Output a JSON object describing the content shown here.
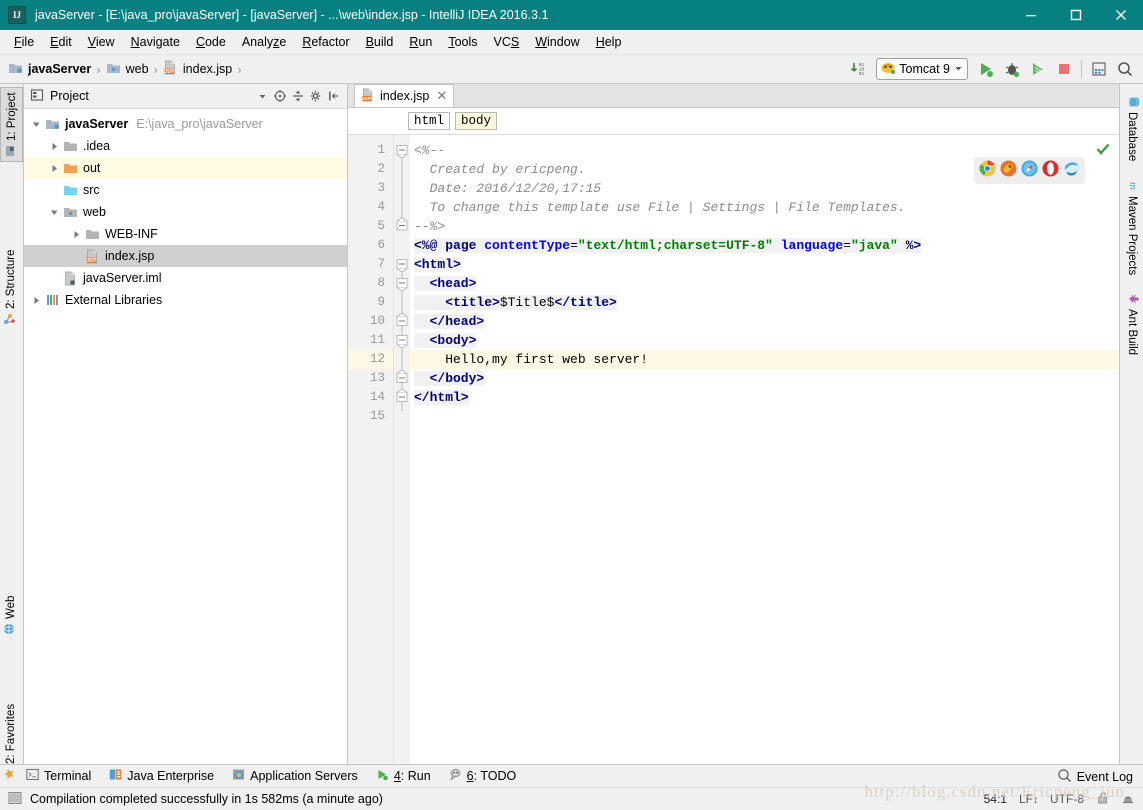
{
  "window": {
    "title": "javaServer - [E:\\java_pro\\javaServer] - [javaServer] - ...\\web\\index.jsp - IntelliJ IDEA 2016.3.1",
    "logo_text": "IJ",
    "accent_color": "#068080",
    "controls": {
      "minimize": "minimize-icon",
      "maximize": "maximize-icon",
      "close": "close-icon"
    }
  },
  "menubar": {
    "items": [
      {
        "label": "File",
        "mnemonic": "F"
      },
      {
        "label": "Edit",
        "mnemonic": "E"
      },
      {
        "label": "View",
        "mnemonic": "V"
      },
      {
        "label": "Navigate",
        "mnemonic": "N"
      },
      {
        "label": "Code",
        "mnemonic": "C"
      },
      {
        "label": "Analyze",
        "mnemonic": "z"
      },
      {
        "label": "Refactor",
        "mnemonic": "R"
      },
      {
        "label": "Build",
        "mnemonic": "B"
      },
      {
        "label": "Run",
        "mnemonic": "R"
      },
      {
        "label": "Tools",
        "mnemonic": "T"
      },
      {
        "label": "VCS",
        "mnemonic": "S"
      },
      {
        "label": "Window",
        "mnemonic": "W"
      },
      {
        "label": "Help",
        "mnemonic": "H"
      }
    ]
  },
  "navbar": {
    "crumbs": [
      {
        "label": "javaServer",
        "icon": "module-icon",
        "bold": true
      },
      {
        "label": "web",
        "icon": "source-folder-icon",
        "bold": false
      },
      {
        "label": "index.jsp",
        "icon": "jsp-file-icon",
        "bold": false
      }
    ],
    "separator": "›",
    "run_config": {
      "name": "Tomcat 9",
      "icon": "tomcat-icon",
      "dropdown": "chevron-down-icon"
    },
    "buttons": [
      {
        "name": "update-running-application-icon",
        "title": "Update"
      },
      {
        "name": "run-icon",
        "title": "Run"
      },
      {
        "name": "debug-icon",
        "title": "Debug"
      },
      {
        "name": "run-with-coverage-icon",
        "title": "Run with Coverage"
      },
      {
        "name": "stop-icon",
        "title": "Stop"
      },
      {
        "name": "project-structure-icon",
        "title": "Project Structure"
      },
      {
        "name": "search-everywhere-icon",
        "title": "Search Everywhere"
      }
    ]
  },
  "left_stripe": {
    "tabs": [
      {
        "label": "1: Project",
        "icon": "project-icon",
        "active": true
      },
      {
        "label": "2: Structure",
        "icon": "structure-icon",
        "active": false
      },
      {
        "label": "Web",
        "icon": "web-icon",
        "active": false
      },
      {
        "label": "2: Favorites",
        "icon": "star-icon",
        "active": false
      }
    ]
  },
  "right_stripe": {
    "tabs": [
      {
        "label": "Database",
        "icon": "database-icon"
      },
      {
        "label": "Maven Projects",
        "icon": "maven-icon"
      },
      {
        "label": "Ant Build",
        "icon": "ant-icon"
      }
    ]
  },
  "project_panel": {
    "title": "Project",
    "title_icon": "project-view-icon",
    "toolbar": [
      {
        "name": "view-mode-dropdown-icon"
      },
      {
        "name": "scroll-from-source-icon"
      },
      {
        "name": "collapse-all-icon"
      },
      {
        "name": "settings-gear-icon"
      },
      {
        "name": "hide-panel-icon"
      }
    ],
    "tree": [
      {
        "label": "javaServer",
        "sub": "E:\\java_pro\\javaServer",
        "indent": 0,
        "twisty": "expanded",
        "icon": "module-icon",
        "bold": true,
        "state": "normal"
      },
      {
        "label": ".idea",
        "sub": "",
        "indent": 1,
        "twisty": "collapsed",
        "icon": "folder-icon",
        "bold": false,
        "state": "normal"
      },
      {
        "label": "out",
        "sub": "",
        "indent": 1,
        "twisty": "collapsed",
        "icon": "excluded-folder-icon",
        "bold": false,
        "state": "highlight"
      },
      {
        "label": "src",
        "sub": "",
        "indent": 1,
        "twisty": "none",
        "icon": "source-root-icon",
        "bold": false,
        "state": "normal"
      },
      {
        "label": "web",
        "sub": "",
        "indent": 1,
        "twisty": "expanded",
        "icon": "web-root-icon",
        "bold": false,
        "state": "normal"
      },
      {
        "label": "WEB-INF",
        "sub": "",
        "indent": 2,
        "twisty": "collapsed",
        "icon": "folder-icon",
        "bold": false,
        "state": "normal"
      },
      {
        "label": "index.jsp",
        "sub": "",
        "indent": 2,
        "twisty": "none",
        "icon": "jsp-file-icon",
        "bold": false,
        "state": "selected"
      },
      {
        "label": "javaServer.iml",
        "sub": "",
        "indent": 1,
        "twisty": "none",
        "icon": "iml-file-icon",
        "bold": false,
        "state": "normal"
      },
      {
        "label": "External Libraries",
        "sub": "",
        "indent": 0,
        "twisty": "collapsed",
        "icon": "libraries-icon",
        "bold": false,
        "state": "normal"
      }
    ]
  },
  "editor": {
    "tab": {
      "label": "index.jsp",
      "icon": "jsp-file-icon",
      "close": "close-icon"
    },
    "tag_breadcrumbs": [
      {
        "label": "html",
        "highlight": false
      },
      {
        "label": "body",
        "highlight": true
      }
    ],
    "browser_popup": [
      {
        "name": "chrome-icon"
      },
      {
        "name": "firefox-icon"
      },
      {
        "name": "safari-icon"
      },
      {
        "name": "opera-icon"
      },
      {
        "name": "explorer-icon"
      }
    ],
    "inspection_status": "no-errors-check-icon",
    "lines": [
      {
        "num": 1,
        "fold": "start",
        "highlight": false,
        "tokens": [
          {
            "t": "<%--",
            "c": "cmt"
          }
        ]
      },
      {
        "num": 2,
        "fold": "bar",
        "highlight": false,
        "tokens": [
          {
            "t": "  Created by ericpeng.",
            "c": "cmt"
          }
        ]
      },
      {
        "num": 3,
        "fold": "bar",
        "highlight": false,
        "tokens": [
          {
            "t": "  Date: 2016/12/20,17:15",
            "c": "cmt"
          }
        ]
      },
      {
        "num": 4,
        "fold": "bar",
        "highlight": false,
        "tokens": [
          {
            "t": "  To change this template use File | Settings | File Templates.",
            "c": "cmt"
          }
        ]
      },
      {
        "num": 5,
        "fold": "end",
        "highlight": false,
        "tokens": [
          {
            "t": "--%>",
            "c": "cmt"
          }
        ]
      },
      {
        "num": 6,
        "fold": "none",
        "highlight": false,
        "tokens": [
          {
            "t": "<%@ ",
            "c": "tag"
          },
          {
            "t": "page ",
            "c": "tag"
          },
          {
            "t": "contentType",
            "c": "attr"
          },
          {
            "t": "=",
            "c": "txt"
          },
          {
            "t": "\"text/html;charset=UTF-8\"",
            "c": "str"
          },
          {
            "t": " ",
            "c": "txt"
          },
          {
            "t": "language",
            "c": "attr"
          },
          {
            "t": "=",
            "c": "txt"
          },
          {
            "t": "\"java\"",
            "c": "str"
          },
          {
            "t": " %>",
            "c": "tag"
          }
        ]
      },
      {
        "num": 7,
        "fold": "start",
        "highlight": false,
        "tokens": [
          {
            "t": "<html>",
            "c": "tag"
          }
        ]
      },
      {
        "num": 8,
        "fold": "start",
        "highlight": false,
        "tokens": [
          {
            "t": "  <head>",
            "c": "tag"
          }
        ]
      },
      {
        "num": 9,
        "fold": "bar",
        "highlight": false,
        "tokens": [
          {
            "t": "    <title>",
            "c": "tag"
          },
          {
            "t": "$Title$",
            "c": "txt"
          },
          {
            "t": "</title>",
            "c": "tag"
          }
        ]
      },
      {
        "num": 10,
        "fold": "end",
        "highlight": false,
        "tokens": [
          {
            "t": "  </head>",
            "c": "tag"
          }
        ]
      },
      {
        "num": 11,
        "fold": "start",
        "highlight": false,
        "tokens": [
          {
            "t": "  <body>",
            "c": "tag"
          }
        ]
      },
      {
        "num": 12,
        "fold": "bar",
        "highlight": true,
        "tokens": [
          {
            "t": "    Hello,my first web server!",
            "c": "txt"
          }
        ]
      },
      {
        "num": 13,
        "fold": "end",
        "highlight": false,
        "tokens": [
          {
            "t": "  </body>",
            "c": "tag"
          }
        ]
      },
      {
        "num": 14,
        "fold": "end",
        "highlight": false,
        "tokens": [
          {
            "t": "</html>",
            "c": "tag"
          }
        ]
      },
      {
        "num": 15,
        "fold": "none",
        "highlight": false,
        "tokens": [
          {
            "t": "",
            "c": "txt"
          }
        ]
      }
    ]
  },
  "bottom_bar": {
    "items": [
      {
        "label": "Terminal",
        "icon": "terminal-icon",
        "mnemonic": ""
      },
      {
        "label": "Java Enterprise",
        "icon": "java-enterprise-icon",
        "mnemonic": ""
      },
      {
        "label": "Application Servers",
        "icon": "application-servers-icon",
        "mnemonic": ""
      },
      {
        "label": "4: Run",
        "icon": "run-icon",
        "mnemonic": "4"
      },
      {
        "label": "6: TODO",
        "icon": "todo-icon",
        "mnemonic": "6"
      }
    ]
  },
  "statusbar": {
    "icon": "status-toggle-icon",
    "message": "Compilation completed successfully in 1s 582ms (a minute ago)",
    "event_log": {
      "label": "Event Log",
      "icon": "search-icon"
    },
    "caret_position": "54:1",
    "line_separator": "LF",
    "encoding": "UTF-8",
    "lock_icon": "unlocked-icon",
    "inspection_icon": "hector-icon",
    "watermark": "http://blog.csdn.net/Ericpeng_jun"
  }
}
